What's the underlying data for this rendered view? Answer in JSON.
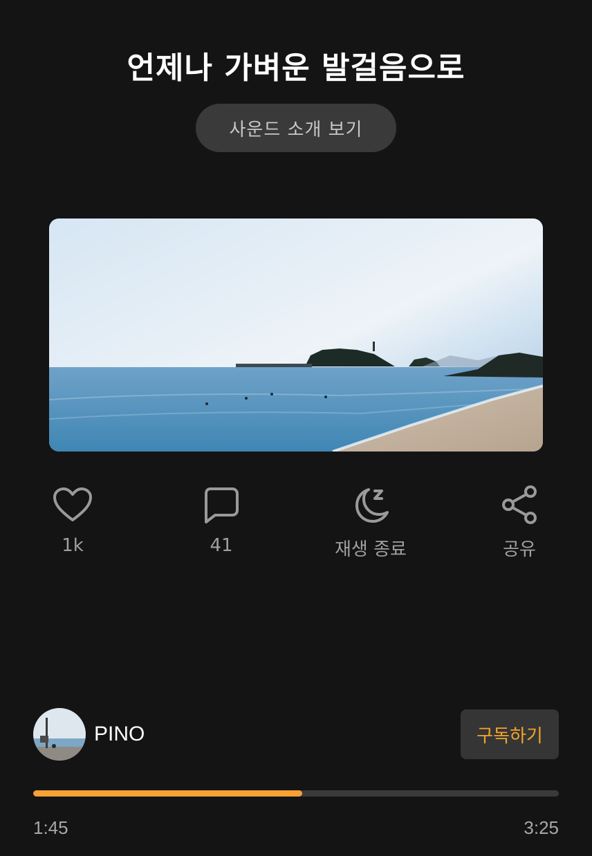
{
  "track": {
    "title": "언제나 가벼운 발걸음으로",
    "intro_button": "사운드 소개 보기"
  },
  "actions": {
    "like": {
      "icon": "heart-icon",
      "label": "1k"
    },
    "comment": {
      "icon": "comment-icon",
      "label": "41"
    },
    "sleep_timer": {
      "icon": "moon-sleep-icon",
      "label": "재생 종료"
    },
    "share": {
      "icon": "share-icon",
      "label": "공유"
    }
  },
  "artist": {
    "name": "PINO",
    "subscribe_label": "구독하기"
  },
  "player": {
    "current_time": "1:45",
    "total_time": "3:25",
    "progress": 0.512
  },
  "colors": {
    "background": "#141414",
    "accent": "#f9a134",
    "subscribe_text": "#f5a42a"
  }
}
